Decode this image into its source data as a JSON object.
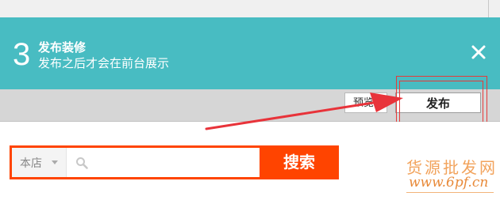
{
  "banner": {
    "step_number": "3",
    "title": "发布装修",
    "description": "发布之后才会在前台展示"
  },
  "toolbar": {
    "preview_label": "预览",
    "publish_label": "发布"
  },
  "search": {
    "scope_label": "本店",
    "input_value": "",
    "button_label": "搜索"
  },
  "watermark": {
    "text_cn": "货源批发网",
    "url": "www.6pf.cn"
  },
  "colors": {
    "banner": "#48bcc2",
    "search_accent": "#ff4400",
    "highlight": "#e53a3a",
    "watermark": "#f2a35c"
  },
  "icons": [
    "close-icon",
    "search-icon",
    "chevron-down-icon",
    "arrow-annotation"
  ]
}
